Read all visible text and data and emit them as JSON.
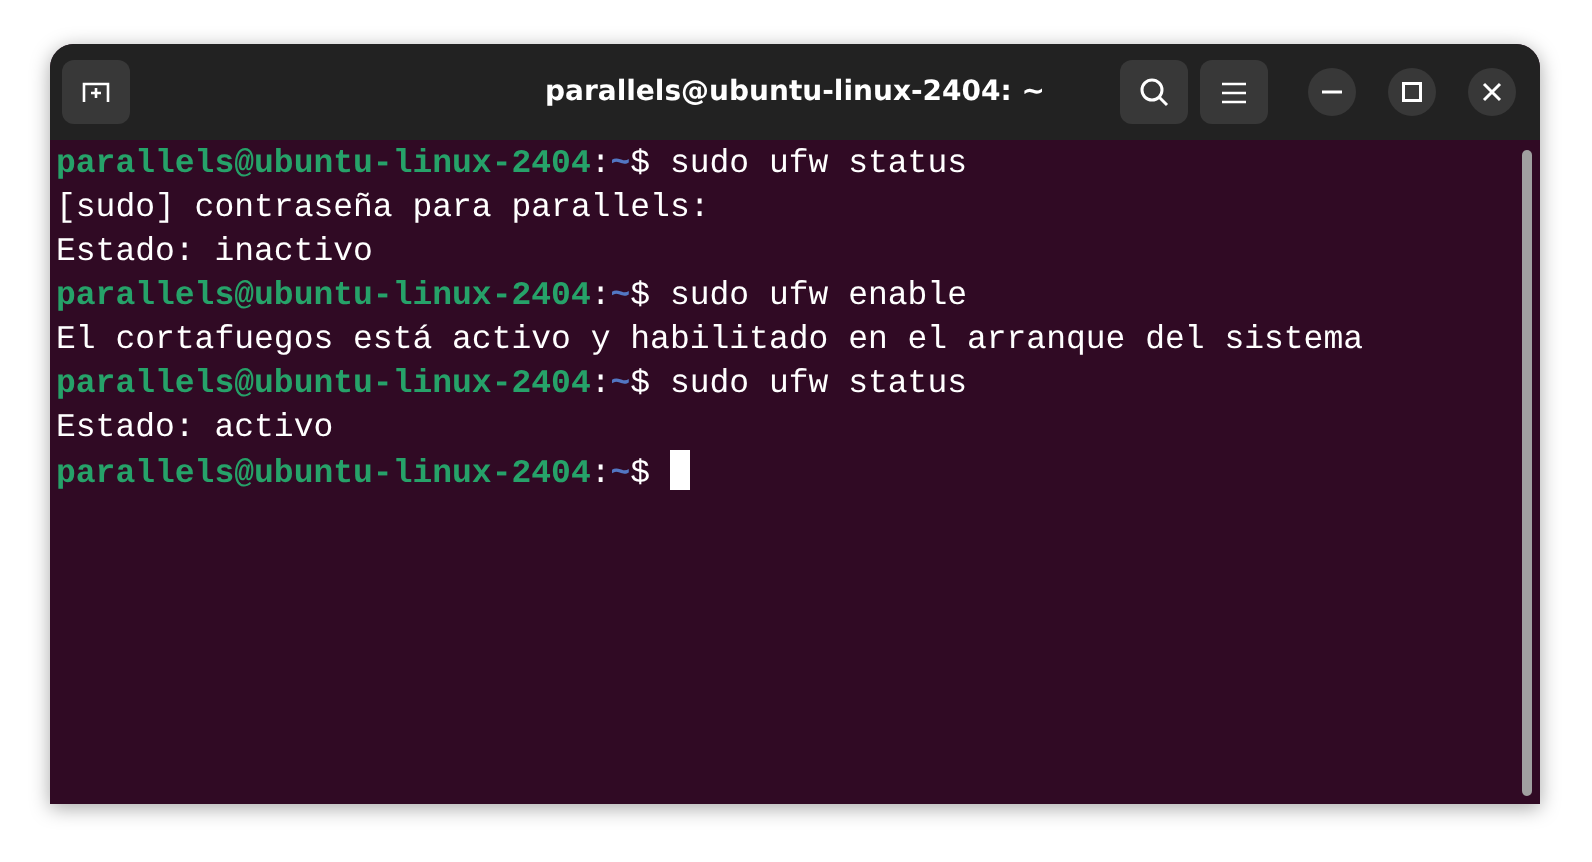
{
  "window": {
    "title": "parallels@ubuntu-linux-2404: ~"
  },
  "terminal": {
    "lines": [
      {
        "kind": "prompt",
        "user_host": "parallels@ubuntu-linux-2404",
        "separator": ":",
        "path": "~",
        "symbol": "$",
        "command": "sudo ufw status",
        "cursor": false
      },
      {
        "kind": "output",
        "text": "[sudo] contraseña para parallels:"
      },
      {
        "kind": "output",
        "text": "Estado: inactivo"
      },
      {
        "kind": "prompt",
        "user_host": "parallels@ubuntu-linux-2404",
        "separator": ":",
        "path": "~",
        "symbol": "$",
        "command": "sudo ufw enable",
        "cursor": false
      },
      {
        "kind": "output",
        "text": "El cortafuegos está activo y habilitado en el arranque del sistema"
      },
      {
        "kind": "prompt",
        "user_host": "parallels@ubuntu-linux-2404",
        "separator": ":",
        "path": "~",
        "symbol": "$",
        "command": "sudo ufw status",
        "cursor": false
      },
      {
        "kind": "output",
        "text": "Estado: activo"
      },
      {
        "kind": "prompt",
        "user_host": "parallels@ubuntu-linux-2404",
        "separator": ":",
        "path": "~",
        "symbol": "$",
        "cursor": true
      }
    ]
  }
}
